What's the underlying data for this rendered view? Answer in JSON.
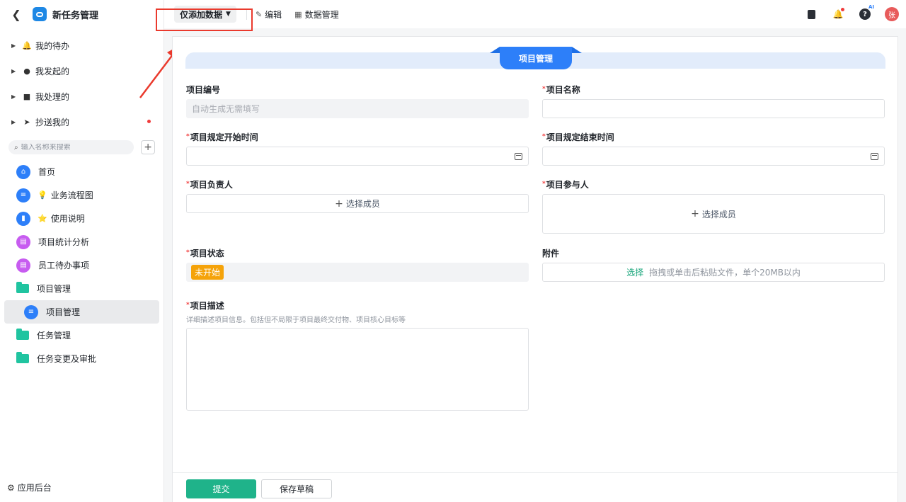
{
  "app": {
    "title": "新任务管理"
  },
  "quick": [
    {
      "label": "我的待办",
      "icon": "bell-icon"
    },
    {
      "label": "我发起的",
      "icon": "play-circle-icon"
    },
    {
      "label": "我处理的",
      "icon": "inbox-icon"
    },
    {
      "label": "抄送我的",
      "icon": "send-icon",
      "unread": true
    }
  ],
  "search": {
    "placeholder": "输入名称来搜索"
  },
  "nav": [
    {
      "label": "首页",
      "icon": "home-icon"
    },
    {
      "label": "业务流程图",
      "icon": "doc-icon",
      "emoji": "💡"
    },
    {
      "label": "使用说明",
      "icon": "bookmark-icon",
      "emoji": "⭐"
    },
    {
      "label": "项目统计分析",
      "icon": "chart-icon"
    },
    {
      "label": "员工待办事项",
      "icon": "chart-icon"
    },
    {
      "label": "项目管理",
      "icon": "folder-icon"
    },
    {
      "label": "项目管理",
      "icon": "doc-icon",
      "active": true
    },
    {
      "label": "任务管理",
      "icon": "folder-icon"
    },
    {
      "label": "任务变更及审批",
      "icon": "folder-icon"
    }
  ],
  "backstage": {
    "label": "应用后台"
  },
  "toolbar": {
    "mode": "仅添加数据",
    "edit": "编辑",
    "data_manage": "数据管理",
    "avatar": "张",
    "ai": "AI"
  },
  "form": {
    "section_title": "项目管理",
    "fields": {
      "project_no": {
        "label": "项目编号",
        "placeholder": "自动生成无需填写"
      },
      "project_name": {
        "label": "项目名称",
        "required": "*"
      },
      "start_time": {
        "label": "项目规定开始时间",
        "required": "*"
      },
      "end_time": {
        "label": "项目规定结束时间",
        "required": "*"
      },
      "owner": {
        "label": "项目负责人",
        "required": "*",
        "action": "选择成员"
      },
      "participants": {
        "label": "项目参与人",
        "required": "*",
        "action": "选择成员"
      },
      "status": {
        "label": "项目状态",
        "required": "*",
        "value": "未开始"
      },
      "attachment": {
        "label": "附件",
        "select": "选择",
        "hint": "拖拽或单击后粘贴文件，单个20MB以内"
      },
      "description": {
        "label": "项目描述",
        "required": "*",
        "hint": "详细描述项目信息。包括但不局限于项目最终交付物、项目核心目标等"
      }
    },
    "submit": "提交",
    "save_draft": "保存草稿"
  },
  "colors": {
    "accent": "#2d7ff9",
    "submit": "#1fb38a",
    "status_tag": "#f5a30a",
    "annotation": "#ea3a2d"
  }
}
